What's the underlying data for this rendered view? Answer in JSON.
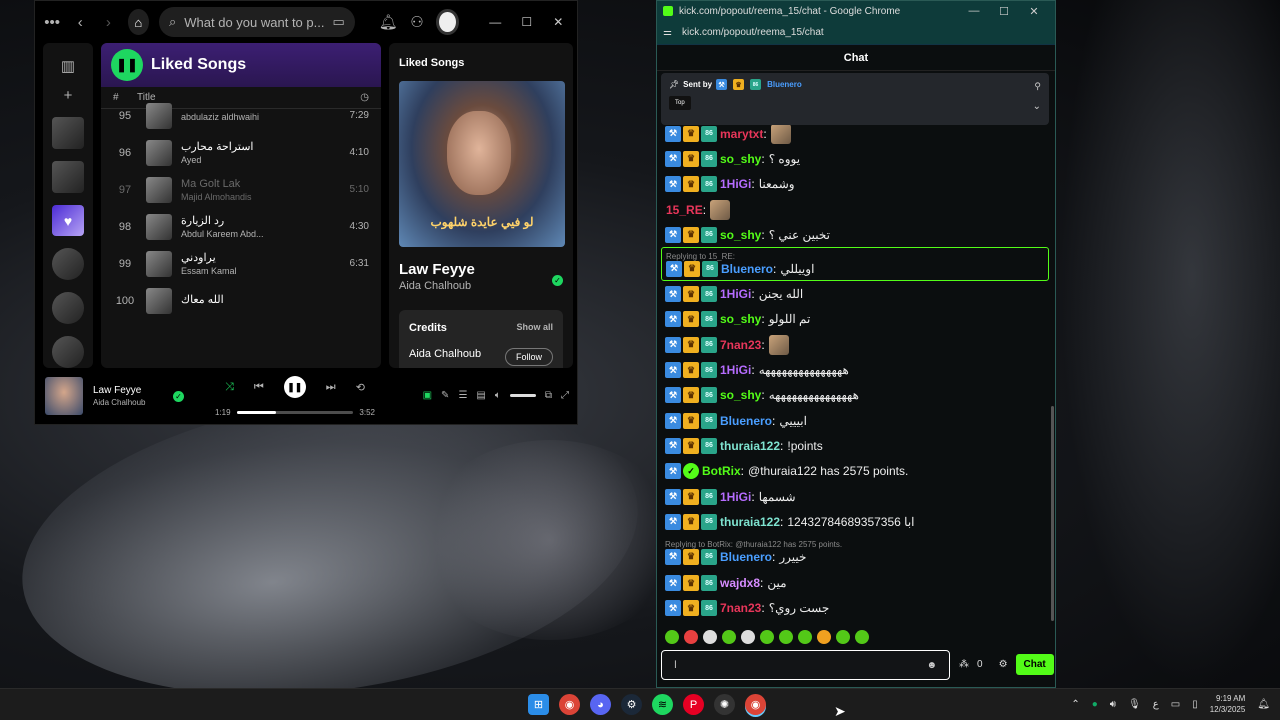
{
  "spotify": {
    "search_placeholder": "What do you want to p...",
    "liked_title": "Liked Songs",
    "col_num": "#",
    "col_title": "Title",
    "tracks": [
      {
        "num": "95",
        "name": "",
        "artist": "abdulaziz aldhwaihi",
        "dur": "7:29",
        "dim": false
      },
      {
        "num": "96",
        "name": "استراحة محارب",
        "artist": "Ayed",
        "dur": "4:10",
        "dim": false
      },
      {
        "num": "97",
        "name": "Ma Golt Lak",
        "artist": "Majid Almohandis",
        "dur": "5:10",
        "dim": true
      },
      {
        "num": "98",
        "name": "رد الزيارة",
        "artist": "Abdul Kareem Abd...",
        "dur": "4:30",
        "dim": false
      },
      {
        "num": "99",
        "name": "يراودني",
        "artist": "Essam Kamal",
        "dur": "6:31",
        "dim": false
      },
      {
        "num": "100",
        "name": "الله معاك",
        "artist": "",
        "dur": "",
        "dim": false
      }
    ],
    "side": {
      "header": "Liked Songs",
      "cover_text": "لو فيي  عايدة شلهوب",
      "song_title": "Law Feyye",
      "song_artist": "Aida Chalhoub",
      "credits_label": "Credits",
      "show_all": "Show all",
      "credit_name": "Aida Chalhoub",
      "follow": "Follow"
    },
    "player": {
      "title": "Law Feyye",
      "artist": "Aida Chalhoub",
      "elapsed": "1:19",
      "total": "3:52",
      "progress": 0.34
    }
  },
  "chrome": {
    "window_title": "kick.com/popout/reema_15/chat - Google Chrome",
    "url": "kick.com/popout/reema_15/chat",
    "chat_title": "Chat",
    "pinned": {
      "sent_by": "Sent by",
      "user": "Bluenero",
      "tag": "Top"
    },
    "messages": [
      {
        "user": "marytxt",
        "color": "#e8365a",
        "text": "",
        "badges": [
          "mod",
          "crown",
          "sub"
        ],
        "emote": true
      },
      {
        "user": "so_shy",
        "color": "#53fc18",
        "text": "يووه ؟",
        "badges": [
          "mod",
          "crown",
          "sub"
        ]
      },
      {
        "user": "1HiGi",
        "color": "#b66cff",
        "text": "وشمعنا",
        "badges": [
          "mod",
          "crown",
          "sub"
        ]
      },
      {
        "user": "15_RE",
        "color": "#e8365a",
        "text": "",
        "badges": [],
        "emote": true
      },
      {
        "user": "so_shy",
        "color": "#53fc18",
        "text": "تخبين عني ؟",
        "badges": [
          "mod",
          "crown",
          "sub"
        ]
      },
      {
        "user": "Bluenero",
        "color": "#4a9eff",
        "text": "اوييللي",
        "badges": [
          "mod",
          "crown",
          "sub"
        ],
        "reply": "Replying to 15_RE:",
        "highlight": true
      },
      {
        "user": "1HiGi",
        "color": "#b66cff",
        "text": "الله يجنن",
        "badges": [
          "mod",
          "crown",
          "sub"
        ]
      },
      {
        "user": "so_shy",
        "color": "#53fc18",
        "text": "تم اللولو",
        "badges": [
          "mod",
          "crown",
          "sub"
        ]
      },
      {
        "user": "7nan23",
        "color": "#e8365a",
        "text": "",
        "badges": [
          "mod",
          "crown",
          "sub"
        ],
        "emote": true
      },
      {
        "user": "1HiGi",
        "color": "#b66cff",
        "text": "هههههههههههههههه",
        "badges": [
          "mod",
          "crown",
          "sub"
        ]
      },
      {
        "user": "so_shy",
        "color": "#53fc18",
        "text": "هههههههههههههههه",
        "badges": [
          "mod",
          "crown",
          "sub"
        ]
      },
      {
        "user": "Bluenero",
        "color": "#4a9eff",
        "text": "ابيييي",
        "badges": [
          "mod",
          "crown",
          "sub"
        ]
      },
      {
        "user": "thuraia122",
        "color": "#7fe3d0",
        "text": "!points",
        "badges": [
          "mod",
          "crown",
          "sub"
        ]
      },
      {
        "user": "BotRix",
        "color": "#53fc18",
        "text": "@thuraia122 has 2575 points.",
        "badges": [
          "mod",
          "bot"
        ]
      },
      {
        "user": "1HiGi",
        "color": "#b66cff",
        "text": "شسمها",
        "badges": [
          "mod",
          "crown",
          "sub"
        ]
      },
      {
        "user": "thuraia122",
        "color": "#7fe3d0",
        "text": "12432784689357356 ابا",
        "badges": [
          "mod",
          "crown",
          "sub"
        ]
      },
      {
        "user": "Bluenero",
        "color": "#4a9eff",
        "text": "خييرر",
        "badges": [
          "mod",
          "crown",
          "sub"
        ],
        "reply": "Replying to BotRix: @thuraia122 has 2575 points."
      },
      {
        "user": "wajdx8",
        "color": "#d68cff",
        "text": "مين",
        "badges": [
          "mod",
          "crown",
          "sub"
        ]
      },
      {
        "user": "7nan23",
        "color": "#e8365a",
        "text": "جست روي؟",
        "badges": [
          "mod",
          "crown",
          "sub"
        ]
      }
    ],
    "input_value": "ا",
    "viewer_count": "0",
    "chat_button": "Chat"
  },
  "taskbar": {
    "time": "9:19 AM",
    "date": "12/3/2025",
    "lang": "ع"
  }
}
